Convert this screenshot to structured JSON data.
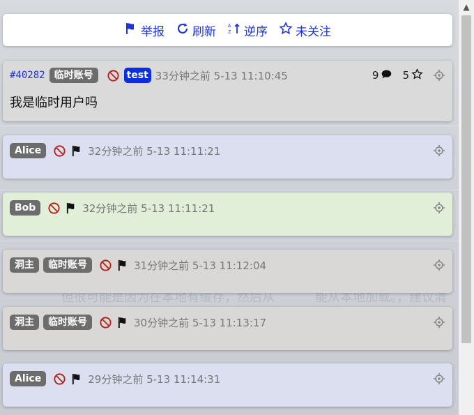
{
  "toolbar": {
    "report_label": "举报",
    "refresh_label": "刷新",
    "reverse_label": "逆序",
    "follow_label": "未关注"
  },
  "main_post": {
    "id": "#40282",
    "badge": "临时账号",
    "tag": "test",
    "time": "33分钟之前 5-13 11:10:45",
    "reply_count": "9",
    "star_count": "5",
    "content": "我是临时用户吗"
  },
  "replies": [
    {
      "author": "Alice",
      "time": "32分钟之前 5-13 11:11:21",
      "bg": "#dbdff0"
    },
    {
      "author": "Bob",
      "time": "32分钟之前 5-13 11:11:21",
      "bg": "#e2efd8"
    },
    {
      "author": "洞主",
      "badge": "临时账号",
      "time": "31分钟之前 5-13 11:12:04",
      "bg": "#dad8d6"
    },
    {
      "author": "洞主",
      "badge": "临时账号",
      "time": "30分钟之前 5-13 11:13:17",
      "bg": "#dad8d6"
    },
    {
      "author": "Alice",
      "time": "29分钟之前 5-13 11:14:31",
      "bg": "#dbdff0"
    }
  ],
  "colors": {
    "accent": "#1f35d6",
    "tag_blue": "#0a2ee0",
    "badge_gray": "#6c6c6c"
  },
  "background_text": [
    "但很可能是因为在本地有缓存，然后从",
    "能从本地加载。，建议清"
  ]
}
